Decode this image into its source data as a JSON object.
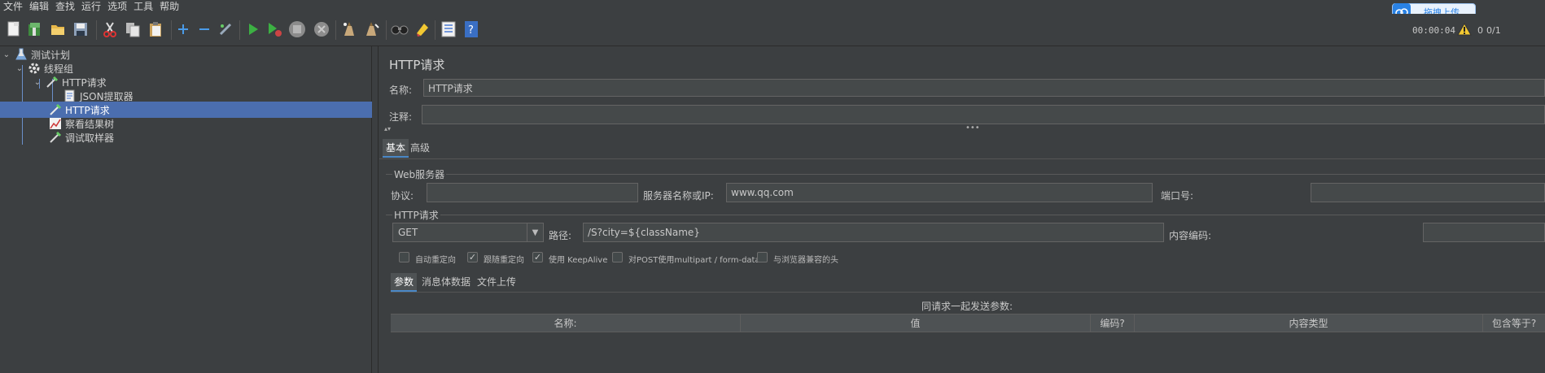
{
  "menu": [
    "文件",
    "编辑",
    "查找",
    "运行",
    "选项",
    "工具",
    "帮助"
  ],
  "toolbar": {
    "buttons": [
      "new-icon",
      "templates-icon",
      "open-icon",
      "save-icon",
      "cut-icon",
      "copy-icon",
      "paste-icon",
      "expand-icon",
      "collapse-icon",
      "toggle-icon",
      "start-icon",
      "start-no-pause-icon",
      "stop-icon",
      "shutdown-icon",
      "clear-icon",
      "clear-all-icon",
      "search-icon",
      "reset-search-icon",
      "function-helper-icon",
      "help-icon"
    ],
    "timer": "00:00:04",
    "error_count": "0",
    "threads": "0/1"
  },
  "upload_float": {
    "label": "拖拽上传"
  },
  "tree": {
    "items": [
      {
        "label": "测试计划",
        "icon": "test-plan-icon",
        "expanded": true
      },
      {
        "label": "线程组",
        "icon": "thread-group-icon",
        "expanded": true
      },
      {
        "label": "HTTP请求",
        "icon": "http-sampler-icon",
        "expanded": true
      },
      {
        "label": "JSON提取器",
        "icon": "json-extractor-icon"
      },
      {
        "label": "HTTP请求",
        "icon": "http-sampler-icon",
        "selected": true
      },
      {
        "label": "察看结果树",
        "icon": "results-tree-icon"
      },
      {
        "label": "调试取样器",
        "icon": "debug-sampler-icon"
      }
    ]
  },
  "panel": {
    "title": "HTTP请求",
    "name_label": "名称:",
    "name_value": "HTTP请求",
    "comment_label": "注释:",
    "comment_value": "",
    "tabs": [
      "基本",
      "高级"
    ],
    "web_server": {
      "group_title": "Web服务器",
      "protocol_label": "协议:",
      "protocol_value": "",
      "server_label": "服务器名称或IP:",
      "server_value": "www.qq.com",
      "port_label": "端口号:",
      "port_value": ""
    },
    "http_request": {
      "group_title": "HTTP请求",
      "method": "GET",
      "path_label": "路径:",
      "path_value": "/S?city=${className}",
      "encoding_label": "内容编码:",
      "encoding_value": ""
    },
    "options": [
      {
        "label": "自动重定向",
        "checked": false
      },
      {
        "label": "跟随重定向",
        "checked": true
      },
      {
        "label": "使用 KeepAlive",
        "checked": true
      },
      {
        "label": "对POST使用multipart / form-data",
        "checked": false
      },
      {
        "label": "与浏览器兼容的头",
        "checked": false
      }
    ],
    "body_tabs": [
      "参数",
      "消息体数据",
      "文件上传"
    ],
    "params_caption": "同请求一起发送参数:",
    "columns": [
      "名称:",
      "值",
      "编码?",
      "内容类型",
      "包含等于?"
    ]
  },
  "colors": {
    "background": "#3c3f41",
    "selection": "#4b6eaf",
    "input_bg": "#45494a"
  }
}
